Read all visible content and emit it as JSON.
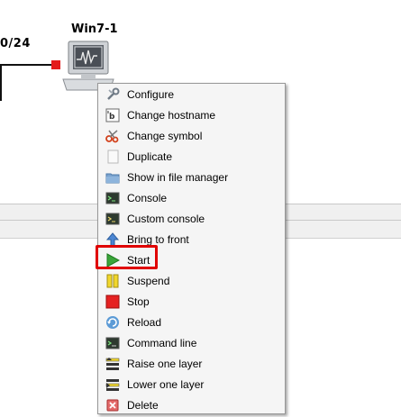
{
  "topology": {
    "link_label": "0/24",
    "node_label": "Win7-1"
  },
  "menu": {
    "items": [
      {
        "label": "Configure",
        "icon": "wrench-icon"
      },
      {
        "label": "Change hostname",
        "icon": "rename-icon"
      },
      {
        "label": "Change symbol",
        "icon": "scissors-icon"
      },
      {
        "label": "Duplicate",
        "icon": "duplicate-icon"
      },
      {
        "label": "Show in file manager",
        "icon": "folder-icon"
      },
      {
        "label": "Console",
        "icon": "console-icon"
      },
      {
        "label": "Custom console",
        "icon": "custom-console-icon"
      },
      {
        "label": "Bring to front",
        "icon": "arrow-up-icon"
      },
      {
        "label": "Start",
        "icon": "play-icon"
      },
      {
        "label": "Suspend",
        "icon": "pause-icon"
      },
      {
        "label": "Stop",
        "icon": "stop-icon"
      },
      {
        "label": "Reload",
        "icon": "reload-icon"
      },
      {
        "label": "Command line",
        "icon": "command-line-icon"
      },
      {
        "label": "Raise one layer",
        "icon": "raise-layer-icon"
      },
      {
        "label": "Lower one layer",
        "icon": "lower-layer-icon"
      },
      {
        "label": "Delete",
        "icon": "delete-icon"
      }
    ],
    "highlighted": "Start"
  },
  "colors": {
    "highlight": "#e00000",
    "link_endpoint": "#e41b1b",
    "menu_background": "#f5f5f5"
  }
}
